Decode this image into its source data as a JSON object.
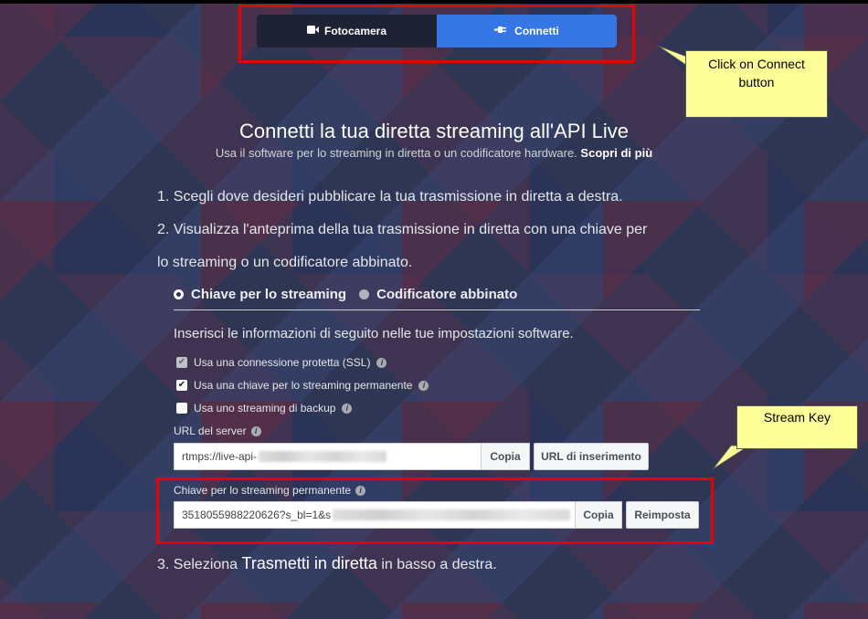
{
  "tabs": [
    {
      "label": "Fotocamera",
      "icon": "camera-icon",
      "active": false
    },
    {
      "label": "Connetti",
      "icon": "plug-icon",
      "active": true
    }
  ],
  "callouts": {
    "connect": "Click on Connect button",
    "stream_key": "Stream Key"
  },
  "header": {
    "title": "Connetti la tua diretta streaming all'API Live",
    "subtitle": "Usa il software per lo streaming in diretta o un codificatore hardware.",
    "learn_more": "Scopri di più"
  },
  "steps": {
    "step1": "1. Scegli dove desideri pubblicare la tua trasmissione in diretta a destra.",
    "step2_line1": "2. Visualizza l'anteprima della tua trasmissione in diretta con una chiave per",
    "step2_line2": "lo streaming o un codificatore abbinato.",
    "step3_prefix": "3. Seleziona",
    "step3_bold": "Trasmetti in diretta",
    "step3_suffix": "in basso a destra."
  },
  "mode": {
    "options": [
      {
        "label": "Chiave per lo streaming",
        "selected": true
      },
      {
        "label": "Codificatore abbinato",
        "selected": false
      }
    ]
  },
  "instructions": "Inserisci le informazioni di seguito nelle tue impostazioni software.",
  "checkboxes": [
    {
      "label": "Usa una connessione protetta (SSL)",
      "checked": true,
      "disabled": true
    },
    {
      "label": "Usa una chiave per lo streaming permanente",
      "checked": true,
      "disabled": false
    },
    {
      "label": "Usa uno streaming di backup",
      "checked": false,
      "disabled": false
    }
  ],
  "server_url": {
    "label": "URL del server",
    "value": "rtmps://live-api-",
    "copy_label": "Copia",
    "ingest_label": "URL di inserimento"
  },
  "stream_key": {
    "label": "Chiave per lo streaming permanente",
    "value": "3518055988220626?s_bl=1&s",
    "copy_label": "Copia",
    "reset_label": "Reimposta"
  },
  "colors": {
    "accent": "#3578e5",
    "highlight": "#e60000",
    "callout": "#ffff99"
  }
}
